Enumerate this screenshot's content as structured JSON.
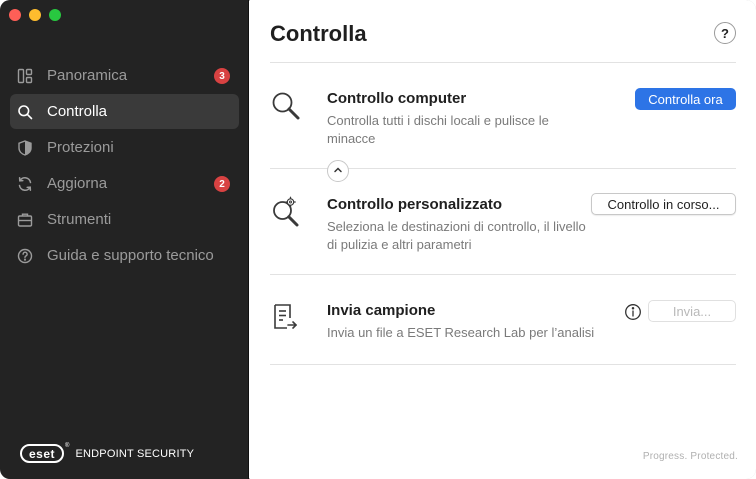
{
  "sidebar": {
    "items": [
      {
        "label": "Panoramica",
        "icon": "dashboard-icon",
        "badge": "3"
      },
      {
        "label": "Controlla",
        "icon": "search-icon",
        "active": true
      },
      {
        "label": "Protezioni",
        "icon": "shield-icon"
      },
      {
        "label": "Aggiorna",
        "icon": "refresh-icon",
        "badge": "2"
      },
      {
        "label": "Strumenti",
        "icon": "toolbox-icon"
      },
      {
        "label": "Guida e supporto tecnico",
        "icon": "help-circle-icon"
      }
    ],
    "brand": {
      "logo": "eset",
      "reg": "®",
      "product": "ENDPOINT SECURITY"
    }
  },
  "main": {
    "title": "Controlla",
    "help_label": "?",
    "sections": [
      {
        "title": "Controllo computer",
        "description": "Controlla tutti i dischi locali e pulisce le minacce",
        "button": "Controlla ora",
        "icon": "magnifier-icon"
      },
      {
        "title": "Controllo personalizzato",
        "description": "Seleziona le destinazioni di controllo, il livello di pulizia e altri parametri",
        "button": "Controllo in corso...",
        "icon": "magnifier-gear-icon"
      },
      {
        "title": "Invia campione",
        "description": "Invia un file a ESET Research Lab per l’analisi",
        "button": "Invia...",
        "icon": "document-send-icon"
      }
    ],
    "footer": "Progress. Protected."
  },
  "colors": {
    "sidebar_bg": "#232323",
    "accent": "#2d74e6",
    "badge": "#d84242"
  }
}
